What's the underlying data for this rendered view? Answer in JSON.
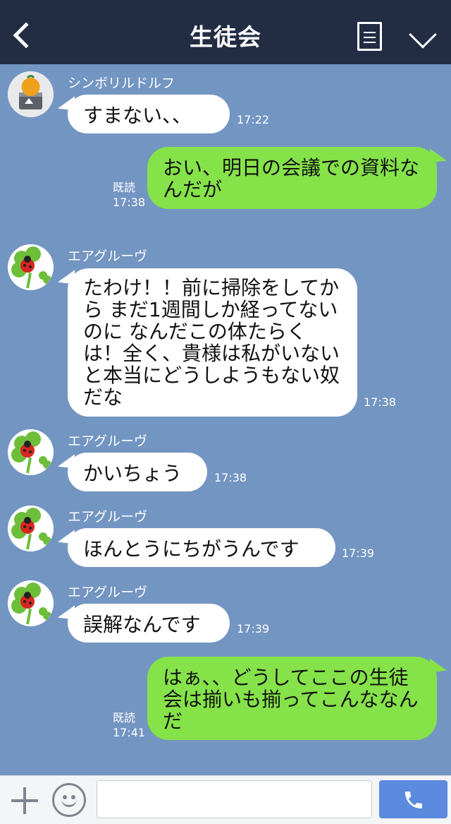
{
  "header": {
    "title": "生徒会",
    "back_icon": "chevron-left-icon",
    "notes_icon": "notes-icon",
    "menu_icon": "chevron-down-icon"
  },
  "messages": [
    {
      "side": "in",
      "sender": "シンボリルドルフ",
      "avatar": "orange-cake-avatar",
      "text": "すまない、、",
      "time": "17:22"
    },
    {
      "side": "out",
      "text": "おい、明日の会議での資料なんだが",
      "read": "既読",
      "time": "17:38"
    },
    {
      "side": "in",
      "sender": "エアグルーヴ",
      "avatar": "ladybug-clover-avatar",
      "text": "たわけ！！前に掃除をしてから まだ1週間しか経ってないのに なんだこの体たらくは！全く、貴様は私がいないと本当にどうしようもない奴だな",
      "time": "17:38"
    },
    {
      "side": "in",
      "sender": "エアグルーヴ",
      "avatar": "ladybug-clover-avatar",
      "text": "かいちょう",
      "time": "17:38"
    },
    {
      "side": "in",
      "sender": "エアグルーヴ",
      "avatar": "ladybug-clover-avatar",
      "text": "ほんとうにちがうんです",
      "time": "17:39"
    },
    {
      "side": "in",
      "sender": "エアグルーヴ",
      "avatar": "ladybug-clover-avatar",
      "text": "誤解なんです",
      "time": "17:39"
    },
    {
      "side": "out",
      "text": "はぁ、、どうしてここの生徒会は揃いも揃ってこんななんだ",
      "read": "既読",
      "time": "17:41"
    }
  ],
  "footer": {
    "plus_icon": "plus-icon",
    "emoji_icon": "smiley-icon",
    "input_placeholder": "",
    "send_icon": "phone-icon"
  },
  "colors": {
    "header_bg": "#222d44",
    "chat_bg": "#7395c2",
    "bubble_out": "#85e249",
    "bubble_in": "#ffffff",
    "send_button": "#5b8ade"
  }
}
